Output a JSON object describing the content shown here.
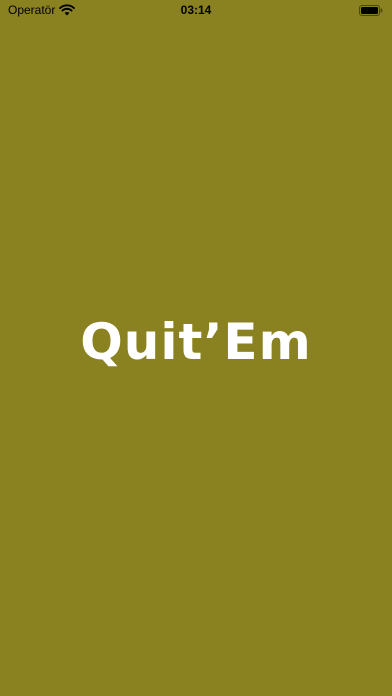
{
  "status_bar": {
    "carrier": "Operatör",
    "time": "03:14",
    "icons": [
      "wifi-icon",
      "battery-icon"
    ]
  },
  "splash": {
    "logo_text": "Quit’Em"
  },
  "colors": {
    "background": "#8a8121",
    "logo": "#ffffff",
    "status_text": "#000000"
  }
}
